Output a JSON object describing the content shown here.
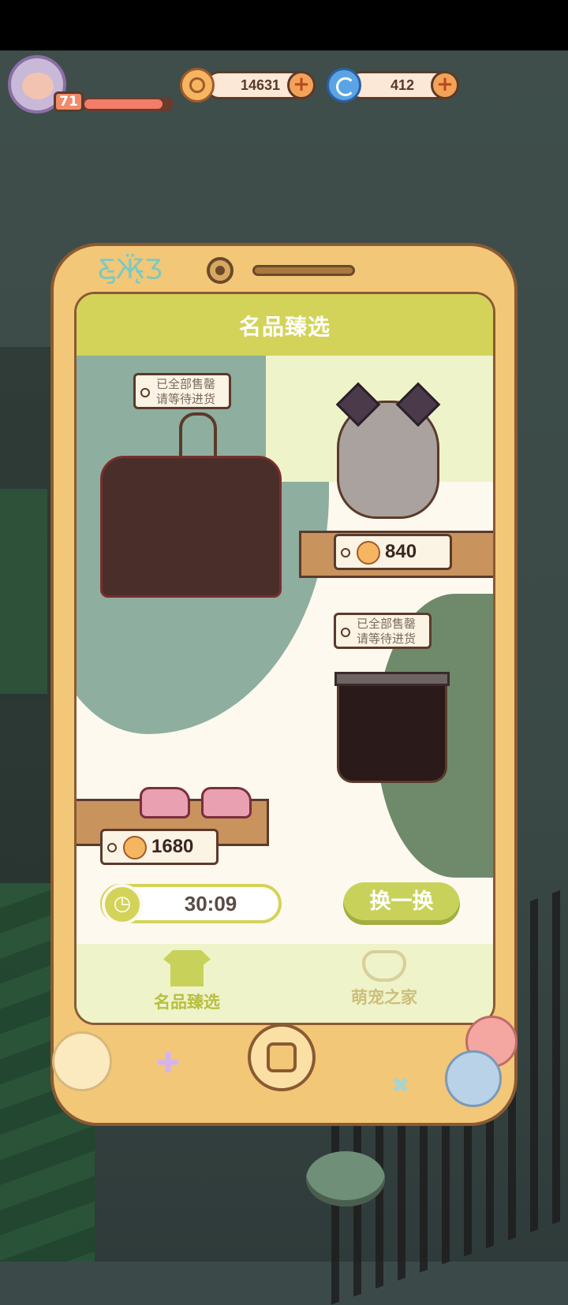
{
  "hud": {
    "level": "71",
    "xp_fraction": 0.9,
    "coins": "14631",
    "gems": "412"
  },
  "panel": {
    "title": "名品臻选",
    "items": [
      {
        "name": "jacket",
        "sold_out_line1": "已全部售罄",
        "sold_out_line2": "请等待进货"
      },
      {
        "name": "cat-ear-wig",
        "price": "840"
      },
      {
        "name": "skirt",
        "sold_out_line1": "已全部售罄",
        "sold_out_line2": "请等待进货"
      },
      {
        "name": "sneakers",
        "price": "1680"
      }
    ],
    "timer": "30:09",
    "refresh_label": "换一换"
  },
  "nav": {
    "tab1": "名品臻选",
    "tab2": "萌宠之家"
  },
  "colors": {
    "accent": "#d3d35a",
    "phone": "#f2c778",
    "outline": "#5b3a2a"
  },
  "icons": [
    "coin-icon",
    "gem-icon",
    "plus-icon",
    "clock-icon",
    "shirt-icon",
    "pet-collar-icon",
    "home-button-icon",
    "butterfly-icon"
  ]
}
